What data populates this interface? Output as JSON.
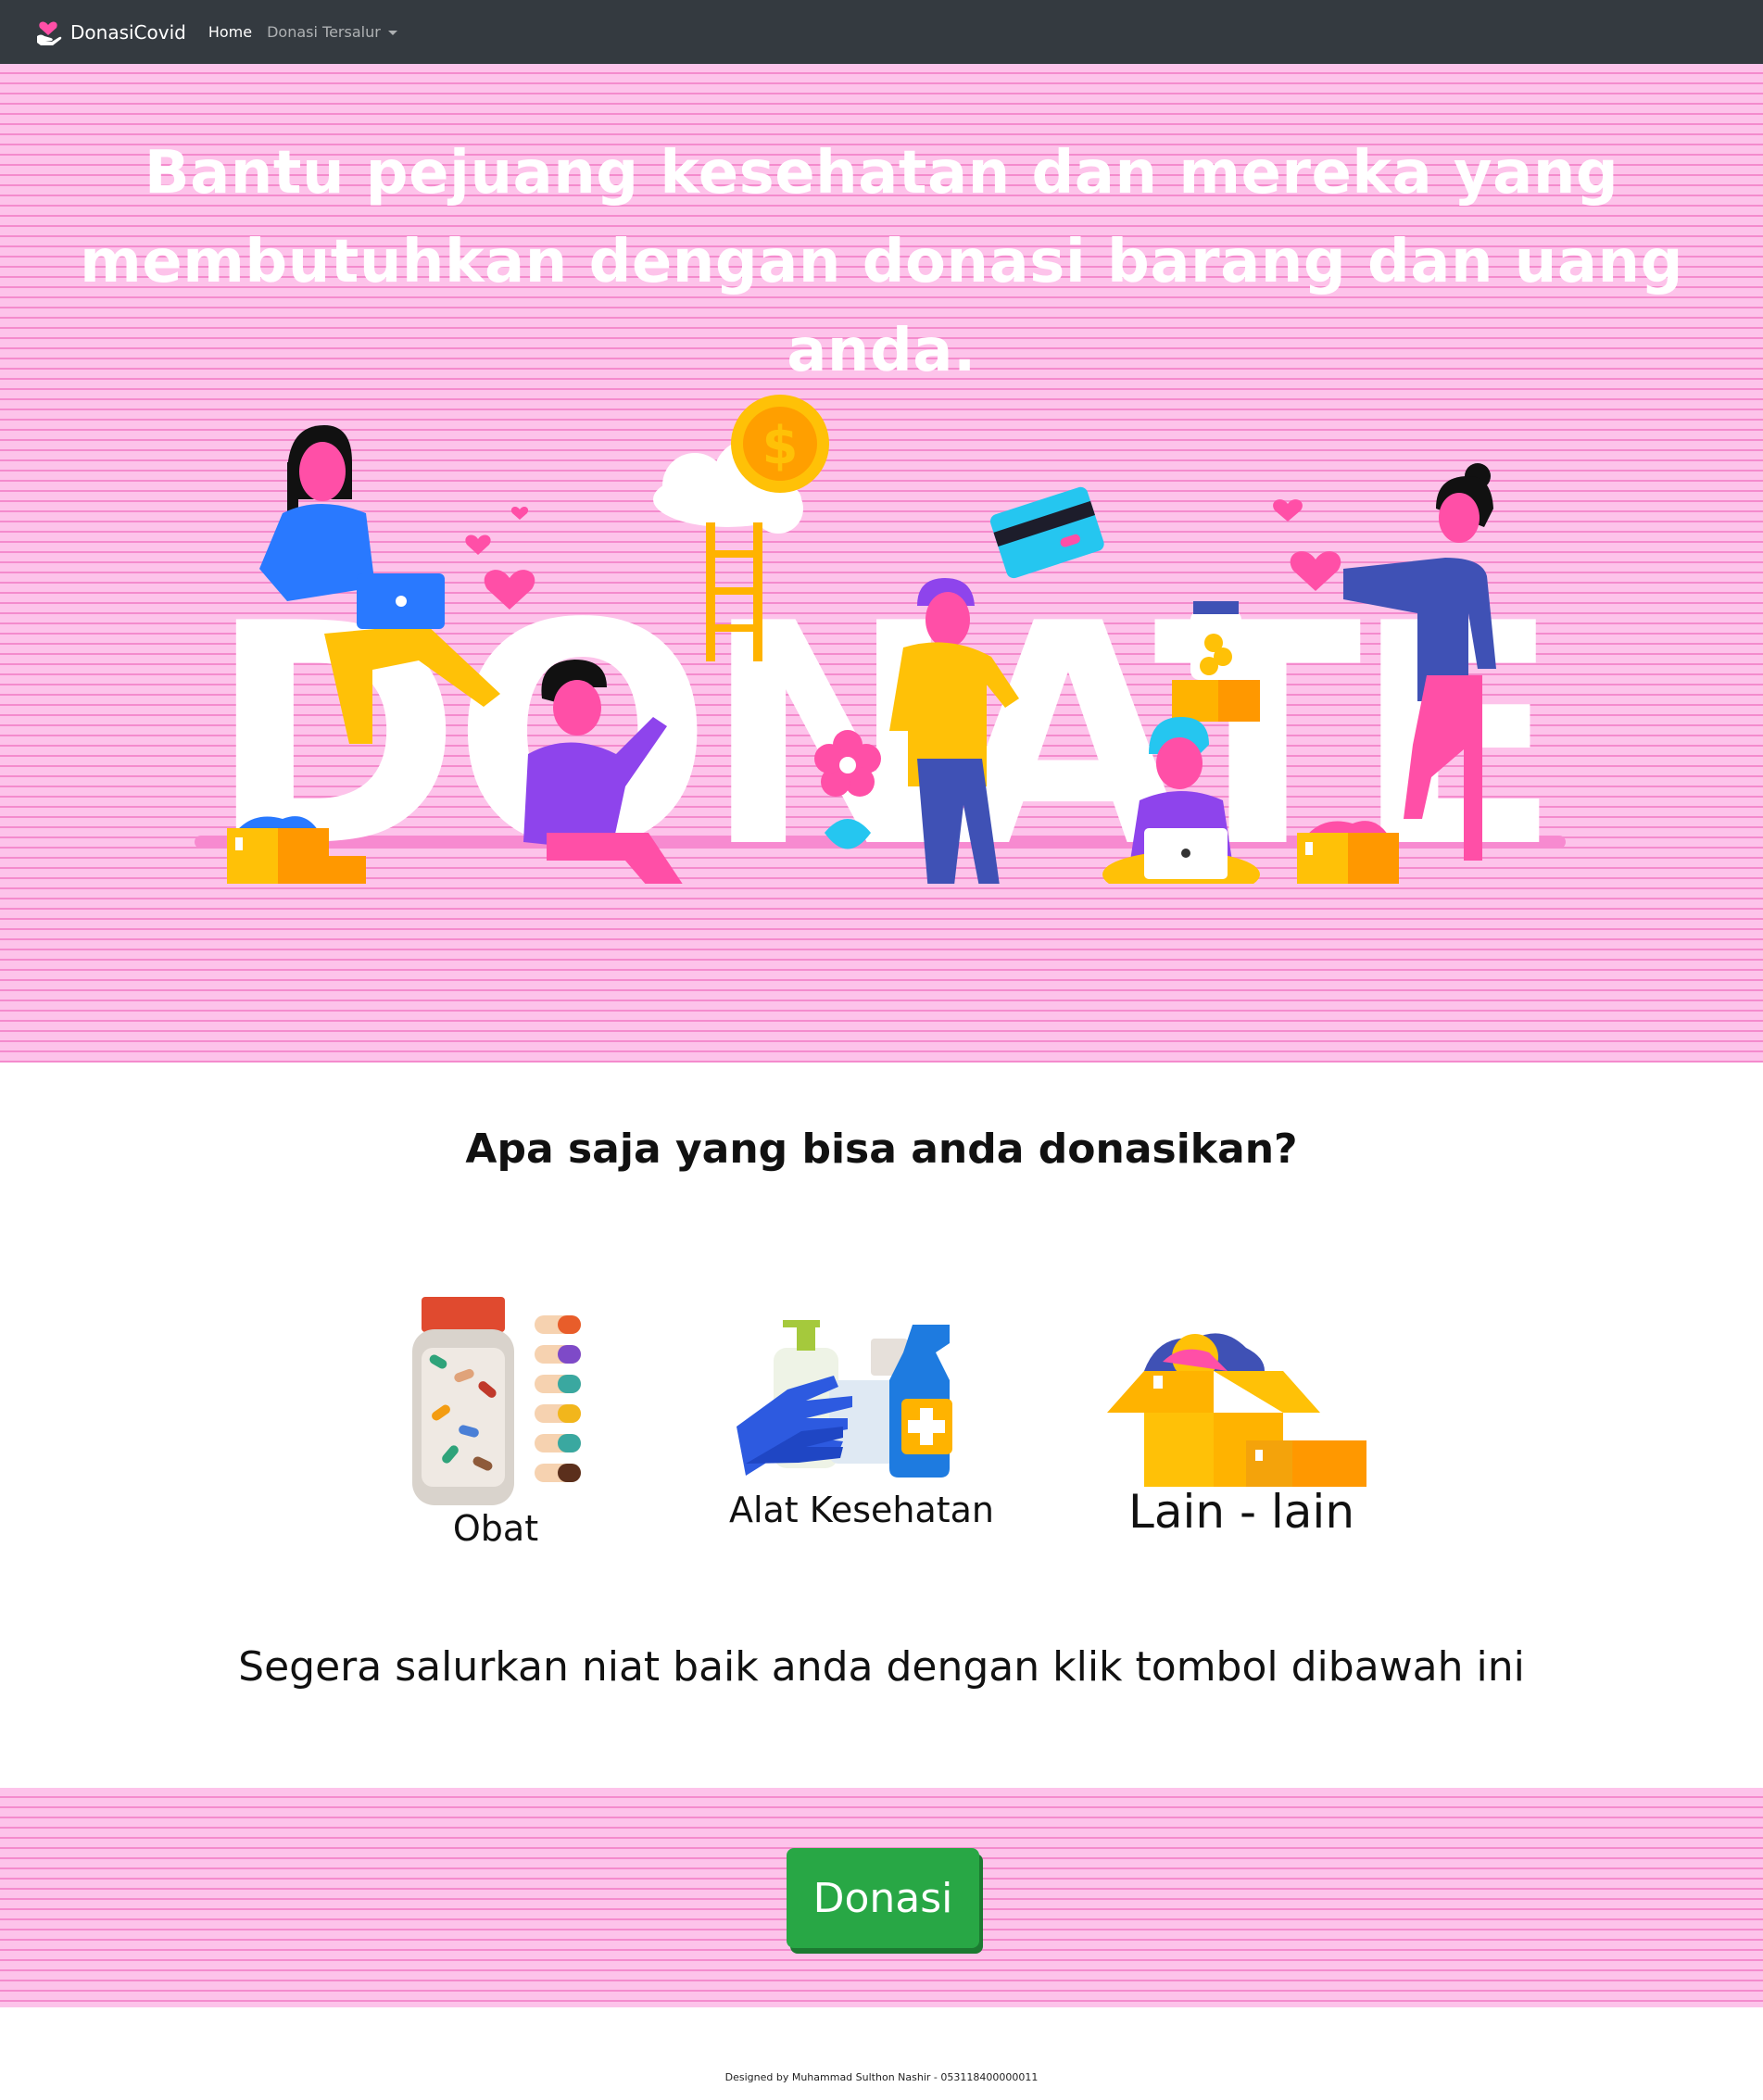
{
  "navbar": {
    "brand": "DonasiCovid",
    "links": [
      {
        "label": "Home",
        "active": true
      },
      {
        "label": "Donasi Tersalur",
        "dropdown": true
      }
    ]
  },
  "hero": {
    "headline": "Bantu pejuang kesehatan dan mereka yang membutuhkan dengan donasi barang dan uang anda.",
    "illustration_text": "DONATE"
  },
  "categories": {
    "title": "Apa saja yang bisa anda donasikan?",
    "items": [
      {
        "label": "Obat",
        "icon": "medicine-jar-icon"
      },
      {
        "label": "Alat Kesehatan",
        "icon": "health-equipment-icon"
      },
      {
        "label": "Lain - lain",
        "icon": "boxes-icon"
      }
    ]
  },
  "cta": {
    "text": "Segera salurkan niat baik anda dengan klik tombol dibawah ini",
    "button_label": "Donasi"
  },
  "footer": {
    "credit": "Designed by Muhammad Sulthon Nashir - 053118400000011"
  },
  "colors": {
    "navbar": "#343a40",
    "stripe_pink": "#fdc3ea",
    "stripe_line": "#f48bcd",
    "button_green": "#28a745"
  }
}
